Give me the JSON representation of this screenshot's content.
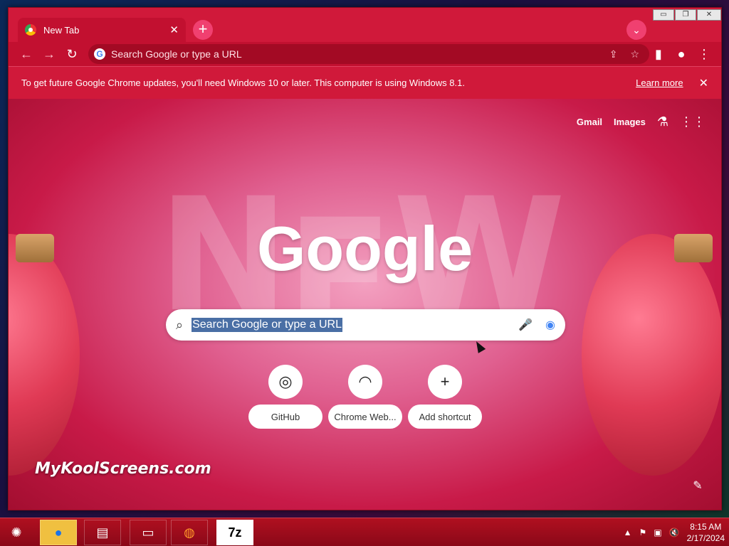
{
  "window": {
    "controls": [
      "▭",
      "❐",
      "✕"
    ]
  },
  "tab": {
    "title": "New Tab",
    "close": "✕"
  },
  "toolbar": {
    "omnibox_placeholder": "Search Google or type a URL",
    "back": "←",
    "forward": "→",
    "reload": "↻",
    "share": "⇪",
    "bookmark": "☆",
    "sidepanel": "▮",
    "profile": "●",
    "menu": "⋮"
  },
  "infobar": {
    "message": "To get future Google Chrome updates, you'll need Windows 10 or later. This computer is using Windows 8.1.",
    "learn_more": "Learn more",
    "close": "✕"
  },
  "ntp": {
    "links": [
      "Gmail",
      "Images"
    ],
    "labs_icon": "⚗",
    "apps_icon": "⋮⋮",
    "logo": "Google",
    "search_placeholder": "Search Google or type a URL",
    "search_icon": "⌕",
    "mic_icon": "🎤",
    "lens_icon": "◉",
    "shortcuts": [
      {
        "label": "GitHub",
        "icon": "◎"
      },
      {
        "label": "Chrome Web...",
        "icon": "◠"
      },
      {
        "label": "Add shortcut",
        "icon": "+"
      }
    ],
    "watermark": "MyKoolScreens.com",
    "customize_icon": "✎",
    "background_letters": [
      "N",
      "E",
      "W"
    ]
  },
  "taskbar": {
    "items": [
      "●",
      "▤",
      "▭",
      "◍",
      "7z"
    ],
    "time": "8:15 AM",
    "date": "2/17/2024",
    "tray_icons": [
      "▲",
      "⚑",
      "▣",
      "🔇"
    ]
  }
}
